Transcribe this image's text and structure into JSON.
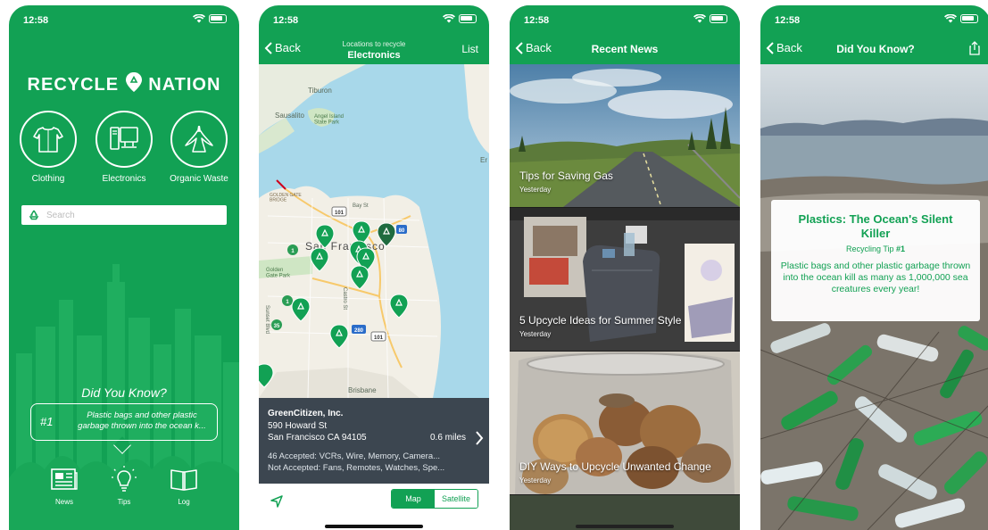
{
  "status_time": "12:58",
  "colors": {
    "brand_green": "#12a154",
    "info_panel": "#3c4650"
  },
  "screen1": {
    "logo_left": "RECYCLE",
    "logo_right": "NATION",
    "categories": [
      {
        "label": "Clothing",
        "icon": "shirt-icon"
      },
      {
        "label": "Electronics",
        "icon": "computer-icon"
      },
      {
        "label": "Organic Waste",
        "icon": "banana-peel-icon"
      }
    ],
    "search_placeholder": "Search",
    "did_you_know_title": "Did You Know?",
    "tip_number": "#1",
    "tip_text": "Plastic bags and other plastic garbage thrown into the ocean k...",
    "tabs": [
      {
        "label": "News",
        "icon": "newspaper-icon"
      },
      {
        "label": "Tips",
        "icon": "lightbulb-icon"
      },
      {
        "label": "Log",
        "icon": "book-icon"
      }
    ]
  },
  "screen2": {
    "back_label": "Back",
    "nav_subtitle": "Locations to recycle",
    "nav_title": "Electronics",
    "nav_right": "List",
    "map_labels": {
      "tiburon": "Tiburon",
      "sausalito": "Sausalito",
      "angel_island": "Angel Island\nState Park",
      "golden_gate_bridge": "GOLDEN GATE\nBRIDGE",
      "golden_gate_park": "Golden\nGate Park",
      "san_francisco": "San Francisco",
      "bay_st": "Bay St",
      "castro_st": "Castro St",
      "sunset_blvd": "Sunset Blvd",
      "brisbane": "Brisbane",
      "east_edge": "Er",
      "shield_101": "101",
      "shield_280": "280",
      "shield_80": "80",
      "shield_1": "1",
      "shield_35": "35"
    },
    "location": {
      "name": "GreenCitizen, Inc.",
      "street": "590 Howard St",
      "city": "San Francisco CA 94105",
      "distance": "0.6 miles",
      "accepted": "46 Accepted:  VCRs, Wire, Memory, Camera...",
      "not_accepted": "Not Accepted:  Fans, Remotes, Watches, Spe..."
    },
    "segment": [
      "Map",
      "Satellite"
    ],
    "segment_selected": "Map"
  },
  "screen3": {
    "back_label": "Back",
    "nav_title": "Recent News",
    "articles": [
      {
        "title": "Tips for Saving Gas",
        "date": "Yesterday"
      },
      {
        "title": "5 Upcycle Ideas for Summer Style",
        "date": "Yesterday"
      },
      {
        "title": "DIY Ways to Upcycle Unwanted Change",
        "date": "Yesterday"
      }
    ]
  },
  "screen4": {
    "back_label": "Back",
    "nav_title": "Did You Know?",
    "card_title": "Plastics: The Ocean's Silent Killer",
    "tip_prefix": "Recycling Tip",
    "tip_number": "#1",
    "card_body": "Plastic bags and other plastic garbage thrown into the ocean kill as many as 1,000,000 sea creatures every year!"
  }
}
